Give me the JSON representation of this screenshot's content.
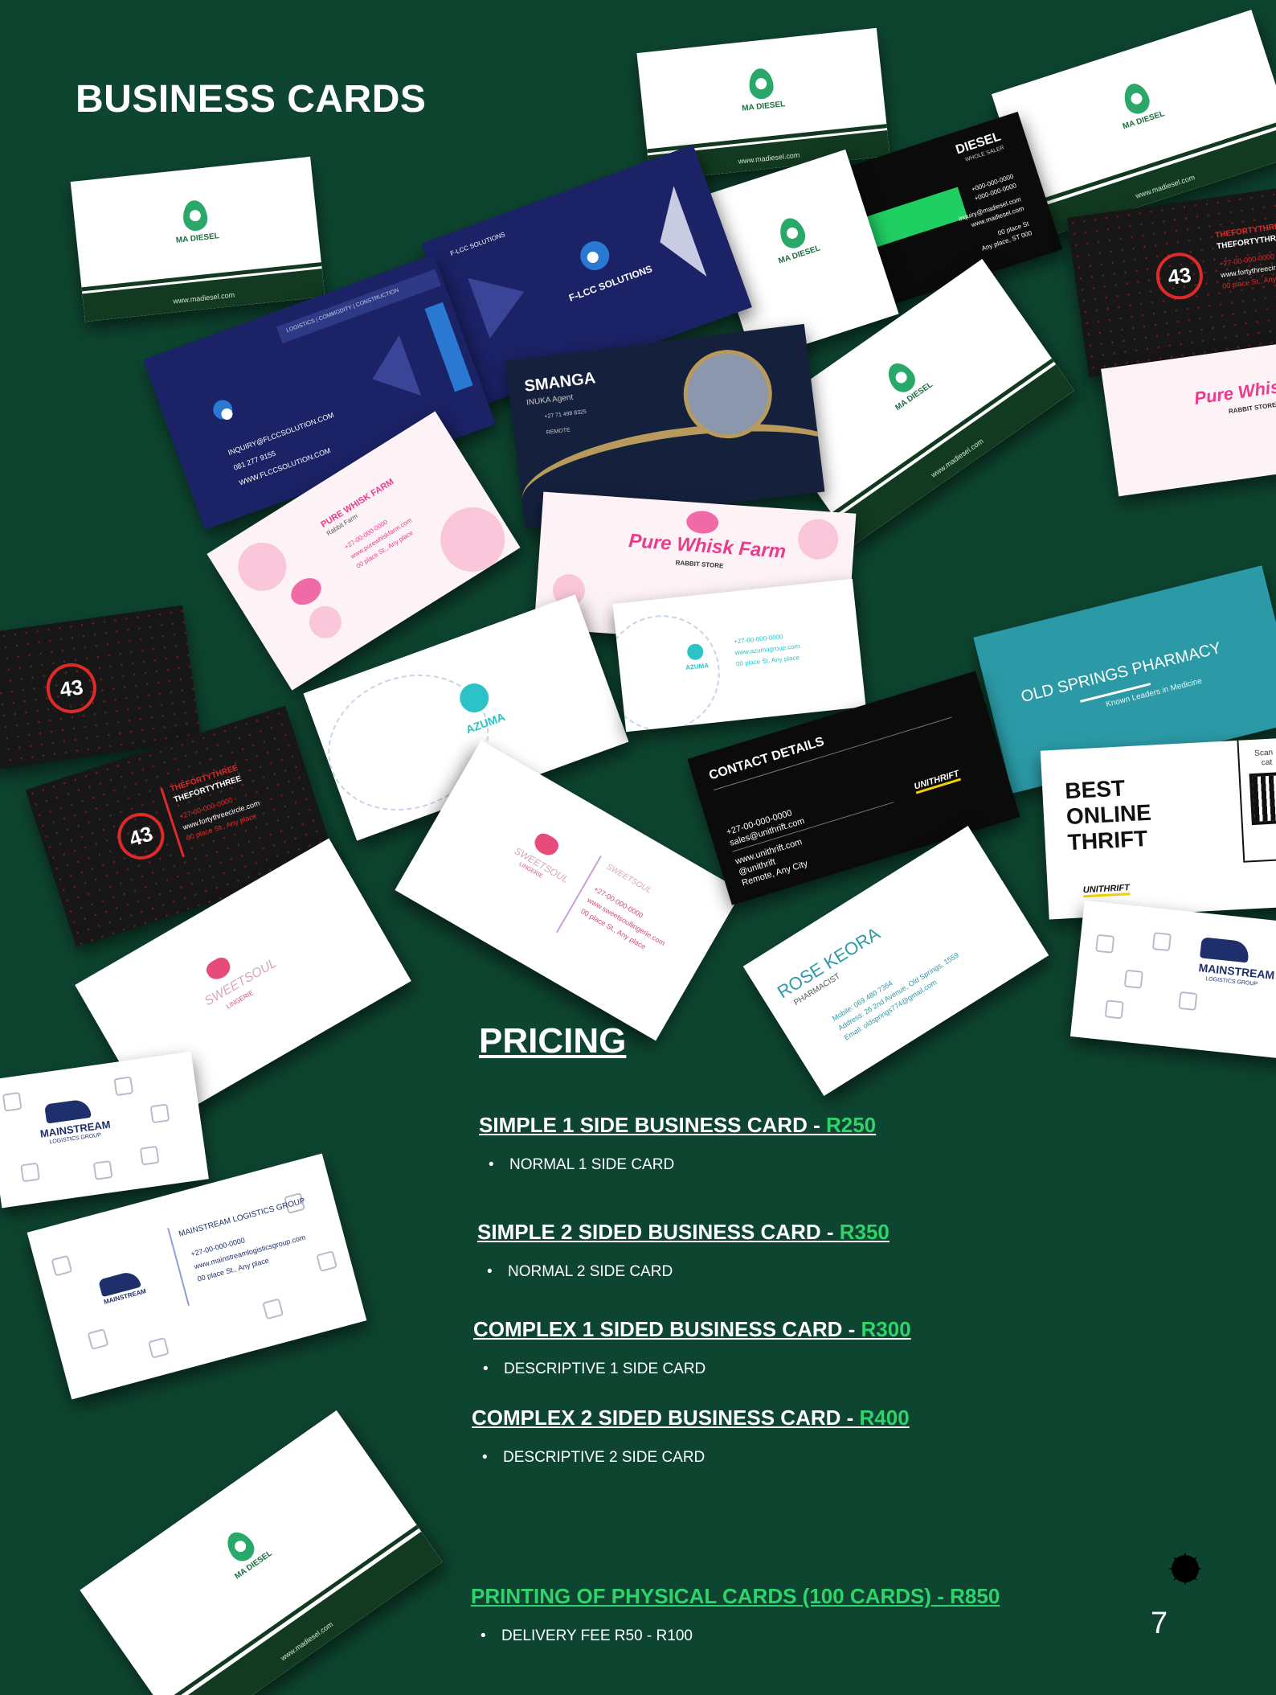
{
  "page": {
    "title": "BUSINESS CARDS",
    "page_number": "7"
  },
  "cards": {
    "ma_brand": "MA DIESEL",
    "ma_url": "www.madiesel.com",
    "diesel_title": "DIESEL",
    "diesel_sub": "WHOLE SALER",
    "diesel_phone1": "+000-000-0000",
    "diesel_phone2": "+000-000-0000",
    "diesel_email": "inquiry@madiesel.com",
    "diesel_web": "www.madiesel.com",
    "diesel_addr1": "00 place St",
    "diesel_addr2": "Any place, ST 000",
    "flcc_name": "F-LCC SOLUTIONS",
    "flcc_tagline": "LOGISTICS | COMMODITY | CONSTRUCTION",
    "flcc_email": "INQUIRY@FLCCSOLUTION.COM",
    "flcc_phone": "081 277 9155",
    "flcc_web": "WWW.FLCCSOLUTION.COM",
    "smanga_name": "SMANGA",
    "smanga_role": "INUKA Agent",
    "smanga_phone": "+27 71 498 8325",
    "smanga_loc": "REMOTE",
    "pure_name": "Pure Whisk Farm",
    "pure_sub": "RABBIT STORE",
    "pure_title": "PURE WHISK FARM",
    "pure_role": "Rabbit Farm",
    "pure_phone": "+27-00-000-0000",
    "pure_web": "www.purewhiskfarm.com",
    "pure_addr": "00 place St., Any place",
    "t43_logo": "43",
    "t43_name1": "THEFORTYTHREE",
    "t43_name2": "THEFORTYTHREE",
    "t43_phone": "+27-00-000-0000",
    "t43_web": "www.fortythreecircle.com",
    "t43_addr": "00 place St., Any place",
    "azuma_name": "AZUMA",
    "azuma_phone": "+27-00-000-0000",
    "azuma_web": "www.azumagroup.com",
    "azuma_addr": "00 place St, Any place",
    "sweet_name": "SWEETSOUL",
    "sweet_sub": "LINGERIE",
    "sweet_phone": "+27-00-000-0000",
    "sweet_web": "www.sweetsoullingerie.com",
    "sweet_addr": "00 place St., Any place",
    "contact_title": "CONTACT DETAILS",
    "contact_phone": "+27-00-000-0000",
    "contact_email": "sales@unithrift.com",
    "contact_web": "www.unithrift.com",
    "contact_social": "@unithrift",
    "contact_addr": "Remote, Any City",
    "unithrift_logo": "UNITHRIFT",
    "pharmacy_name": "OLD SPRINGS PHARMACY",
    "pharmacy_tagline": "Known Leaders in Medicine",
    "rose_name": "ROSE KEORA",
    "rose_role": "PHARMACIST",
    "rose_mobile": "Mobile: 069 480 7364",
    "rose_address": "Address: 26 2nd Avenue, Old Springs, 1559",
    "rose_email": "Email: oldsprings774@gmail.com",
    "thrift_line1": "BEST",
    "thrift_line2": "ONLINE",
    "thrift_line3": "THRIFT",
    "thrift_scan": "Scan",
    "thrift_scan2": "cat",
    "mainstream_name": "MAINSTREAM",
    "mainstream_sub": "LOGISTICS GROUP",
    "mainstream_title": "MAINSTREAM LOGISTICS GROUP",
    "mainstream_phone": "+27-00-000-0000",
    "mainstream_web": "www.mainstreamlogisticsgroup.com",
    "mainstream_addr": "00 place St., Any place"
  },
  "pricing": {
    "heading": "PRICING",
    "items": [
      {
        "name": "SIMPLE  1 SIDE BUSINESS CARD - ",
        "price": "R250",
        "detail": "NORMAL 1 SIDE CARD"
      },
      {
        "name": "SIMPLE 2 SIDED BUSINESS CARD - ",
        "price": "R350",
        "detail": "NORMAL 2 SIDE CARD"
      },
      {
        "name": "COMPLEX 1 SIDED BUSINESS CARD - ",
        "price": "R300",
        "detail": "DESCRIPTIVE 1 SIDE CARD"
      },
      {
        "name": "COMPLEX 2 SIDED BUSINESS CARD - ",
        "price": "R400",
        "detail": "DESCRIPTIVE 2 SIDE CARD"
      }
    ],
    "printing": "PRINTING OF PHYSICAL CARDS (100 CARDS) - R850",
    "delivery": "DELIVERY FEE R50 - R100"
  },
  "colors": {
    "background": "#0e4530",
    "price_green": "#2ed36b",
    "text": "#ffffff"
  }
}
